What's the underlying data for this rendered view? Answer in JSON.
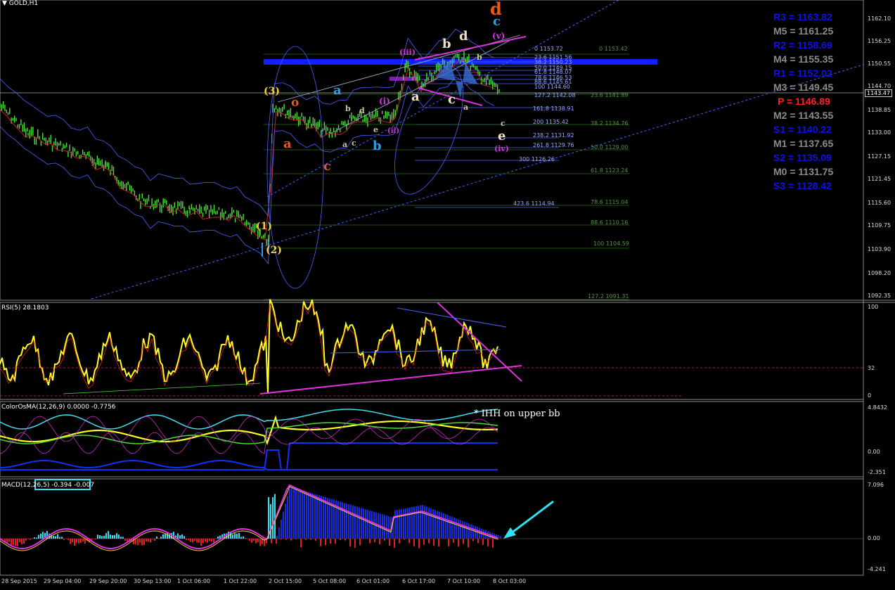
{
  "chart": {
    "symbol_title": "GOLD,H1",
    "current_price": "1143.47",
    "price_axis": [
      "1162.10",
      "1156.25",
      "1150.55",
      "1144.70",
      "1138.85",
      "1133.00",
      "1127.15",
      "1121.45",
      "1115.60",
      "1109.75",
      "1103.90",
      "1098.20",
      "1092.35"
    ],
    "time_axis": [
      "28 Sep 2015",
      "29 Sep 04:00",
      "29 Sep 20:00",
      "30 Sep 13:00",
      "1 Oct 06:00",
      "1 Oct 22:00",
      "2 Oct 15:00",
      "5 Oct 08:00",
      "6 Oct 01:00",
      "6 Oct 17:00",
      "7 Oct 10:00",
      "8 Oct 03:00"
    ]
  },
  "pivots": [
    {
      "label": "R3 = 1163.82",
      "color": "#1010e8"
    },
    {
      "label": "M5 = 1161.25",
      "color": "#8c8c8c"
    },
    {
      "label": "R2 = 1158.69",
      "color": "#1010e8"
    },
    {
      "label": "M4 = 1155.35",
      "color": "#8c8c8c"
    },
    {
      "label": "R1 = 1152.02",
      "color": "#1010e8"
    },
    {
      "label": "M3 = 1149.45",
      "color": "#8c8c8c"
    },
    {
      "label": "P = 1146.89",
      "color": "#ff2020"
    },
    {
      "label": "M2 = 1143.55",
      "color": "#8c8c8c"
    },
    {
      "label": "S1 = 1140.22",
      "color": "#1010e8"
    },
    {
      "label": "M1 = 1137.65",
      "color": "#8c8c8c"
    },
    {
      "label": "S2 = 1135.09",
      "color": "#1010e8"
    },
    {
      "label": "M0 = 1131.75",
      "color": "#8c8c8c"
    },
    {
      "label": "S3 = 1128.42",
      "color": "#1010e8"
    }
  ],
  "fib_left": [
    "0 1153.72",
    "23.6 1151.56",
    "38.2 1150.23",
    "50.0 1149.15",
    "61.8 1148.07",
    "78.6 1146.53",
    "88.6 1145.61",
    "100 1144.60",
    "127.2 1142.08",
    "161.8 1138.91",
    "200 1135.42",
    "238.2 1131.92",
    "261.8 1129.76",
    "300 1126.26",
    "423.6 1114.94"
  ],
  "fib_right": [
    "0 1153.42",
    "23.6 1141.89",
    "38.2 1134.76",
    "50.0 1129.00",
    "61.8 1123.24",
    "78.6 1115.04",
    "88.6 1110.16",
    "100 1104.59",
    "127.2 1091.31"
  ],
  "waves": {
    "w3": "(3)",
    "w1": "(1)",
    "w2": "(2)",
    "o": "o",
    "a_red": "a",
    "c_red": "c",
    "a_blue": "a",
    "b_blue": "b",
    "i": "(i)",
    "ii": "(ii)",
    "iii": "(iii)",
    "iv": "(iv)",
    "v": "(v)",
    "b_small": "b",
    "d_small": "d",
    "a_small": "a",
    "c_small": "c",
    "e_small": "e",
    "b_white": "b",
    "d_white": "d",
    "a_white": "a",
    "c_white": "c",
    "e_white": "e",
    "d_top": "d",
    "c_top": "c",
    "a_green": "a",
    "b_green": "b",
    "c_green": "c"
  },
  "rsi": {
    "label": "RSI(5) 28.1803",
    "axis": [
      "100",
      "32",
      "0"
    ]
  },
  "osma": {
    "label": "ColorOsMA(12,26,9) 0.0000 -0.7756",
    "note": "* IHH on upper bb",
    "axis": [
      "4.8432",
      "0.00",
      "-2.351"
    ]
  },
  "macd": {
    "label": "MACD(12,26,5) -0.394 -0.007",
    "axis": [
      "7.096",
      "0.00",
      "-4.241"
    ]
  }
}
